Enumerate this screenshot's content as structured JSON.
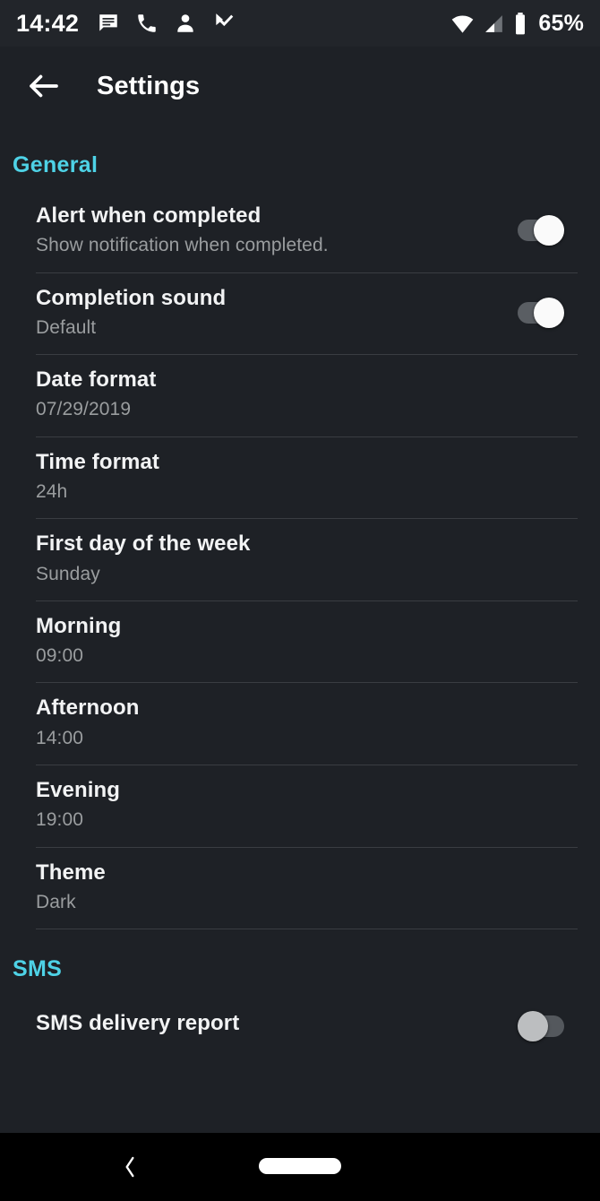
{
  "status_bar": {
    "clock": "14:42",
    "battery_percent": "65%",
    "left_icons": [
      "message-icon",
      "phone-icon",
      "contact-icon",
      "tasks-check-icon"
    ],
    "right_icons": [
      "wifi-icon",
      "cellular-signal-icon",
      "battery-icon"
    ]
  },
  "app_bar": {
    "back_icon": "arrow-back-icon",
    "title": "Settings"
  },
  "colors": {
    "accent": "#4ED2E6",
    "background": "#1E2126",
    "title_text": "#F2F3F4",
    "subtitle_text": "#9A9D9F",
    "divider": "#3A3D42",
    "nav_bar": "#000000"
  },
  "sections": [
    {
      "header": "General",
      "rows": [
        {
          "title": "Alert when completed",
          "subtitle": "Show notification when completed.",
          "control": "toggle",
          "toggle_state": "on"
        },
        {
          "title": "Completion sound",
          "subtitle": "Default",
          "control": "toggle",
          "toggle_state": "on"
        },
        {
          "title": "Date format",
          "subtitle": "07/29/2019",
          "control": "none"
        },
        {
          "title": "Time format",
          "subtitle": "24h",
          "control": "none"
        },
        {
          "title": "First day of the week",
          "subtitle": "Sunday",
          "control": "none"
        },
        {
          "title": "Morning",
          "subtitle": "09:00",
          "control": "none"
        },
        {
          "title": "Afternoon",
          "subtitle": "14:00",
          "control": "none"
        },
        {
          "title": "Evening",
          "subtitle": "19:00",
          "control": "none"
        },
        {
          "title": "Theme",
          "subtitle": "Dark",
          "control": "none"
        }
      ]
    },
    {
      "header": "SMS",
      "rows": [
        {
          "title": "SMS delivery report",
          "subtitle": "",
          "control": "toggle",
          "toggle_state": "off"
        }
      ]
    }
  ],
  "nav_bar": {
    "back_icon": "chevron-left-icon",
    "home_pill": "home-pill-icon"
  }
}
